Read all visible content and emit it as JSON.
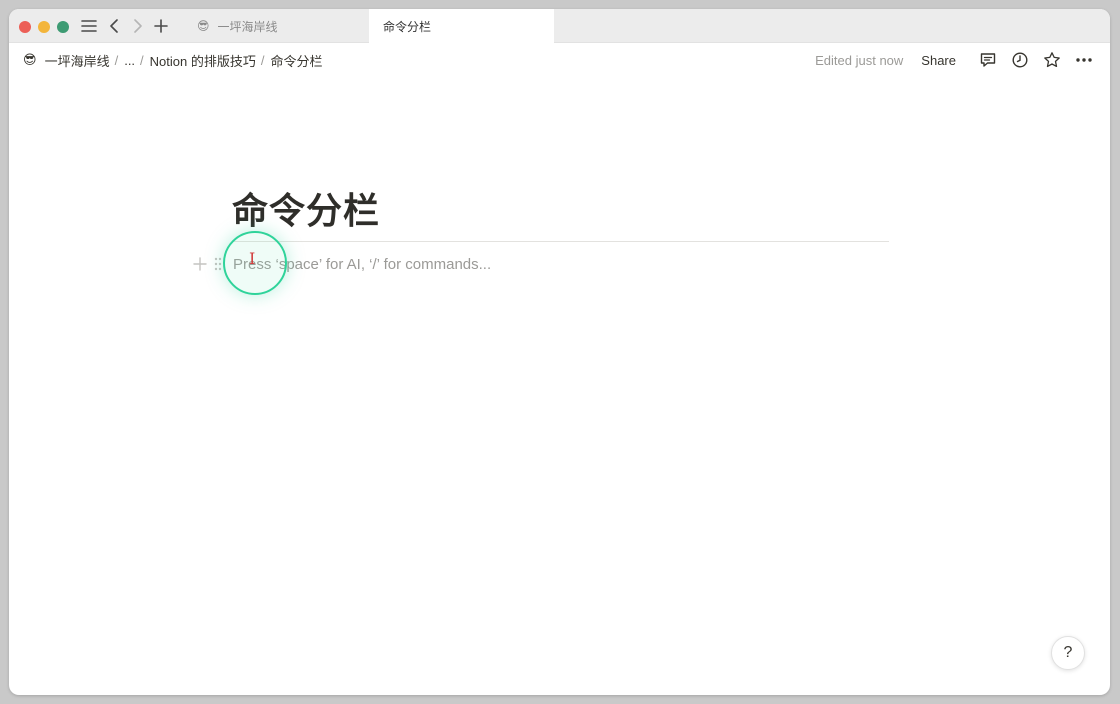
{
  "tabs": [
    {
      "emoji": "😎",
      "label": "一坪海岸线"
    },
    {
      "label": "命令分栏"
    }
  ],
  "breadcrumb": {
    "emoji": "😎",
    "items": [
      "一坪海岸线",
      "...",
      "Notion 的排版技巧",
      "命令分栏"
    ],
    "separator": "/"
  },
  "toolbar": {
    "edited": "Edited just now",
    "share": "Share"
  },
  "page": {
    "title": "命令分栏",
    "placeholder": "Press ‘space’ for AI, ‘/’ for commands..."
  },
  "cursor": {
    "glyph": "I"
  },
  "help": {
    "label": "?"
  }
}
